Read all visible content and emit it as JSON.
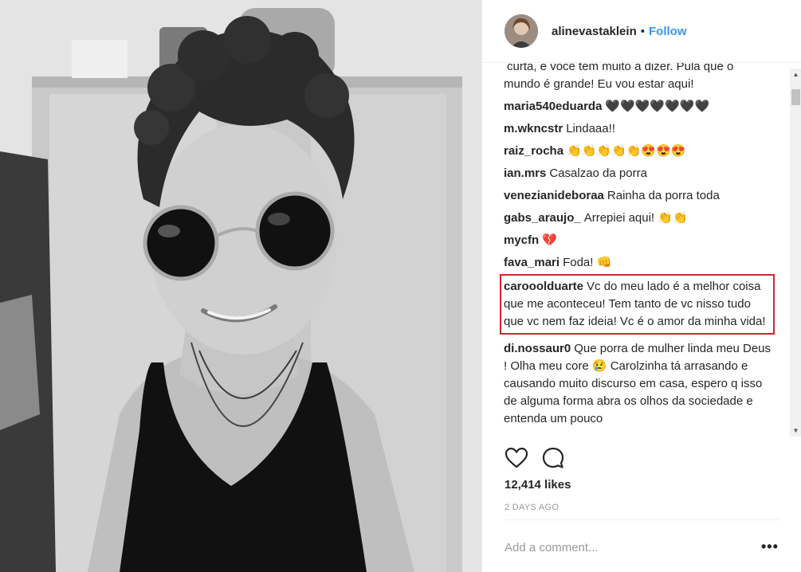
{
  "post": {
    "author": "alinevastaklein",
    "separator": "•",
    "follow_label": "Follow",
    "likes": "12,414 likes",
    "date": "2 DAYS AGO",
    "add_comment_placeholder": "Add a comment...",
    "more_label": "•••"
  },
  "comments": [
    {
      "user": "",
      "text": "curta, e você tem muito a dizer. Pula que o mundo é grande! Eu vou estar aqui!"
    },
    {
      "user": "maria540eduarda",
      "text": "🖤🖤🖤🖤🖤🖤🖤"
    },
    {
      "user": "m.wkncstr",
      "text": "Lindaaa!!"
    },
    {
      "user": "raiz_rocha",
      "text": "👏👏👏👏👏😍😍😍"
    },
    {
      "user": "ian.mrs",
      "text": "Casalzao da porra"
    },
    {
      "user": "venezianideboraa",
      "text": "Rainha da porra toda"
    },
    {
      "user": "gabs_araujo_",
      "text": "Arrepiei aqui! 👏👏"
    },
    {
      "user": "mycfn",
      "text": "💔"
    },
    {
      "user": "fava_mari",
      "text": "Foda! 👊"
    },
    {
      "user": "carooolduarte",
      "text": "Vc do meu lado é a melhor coisa que me aconteceu! Tem tanto de vc nisso tudo que vc nem faz ideia! Vc é o amor da minha vida!"
    },
    {
      "user": "di.nossaur0",
      "text": "Que porra de mulher linda meu Deus ! Olha meu core 😢 Carolzinha tá arrasando e causando muito discurso em casa, espero q isso de alguma forma abra os olhos da sociedade e entenda um pouco"
    }
  ],
  "icons": {
    "like": "heart-icon",
    "comment": "comment-bubble-icon"
  }
}
